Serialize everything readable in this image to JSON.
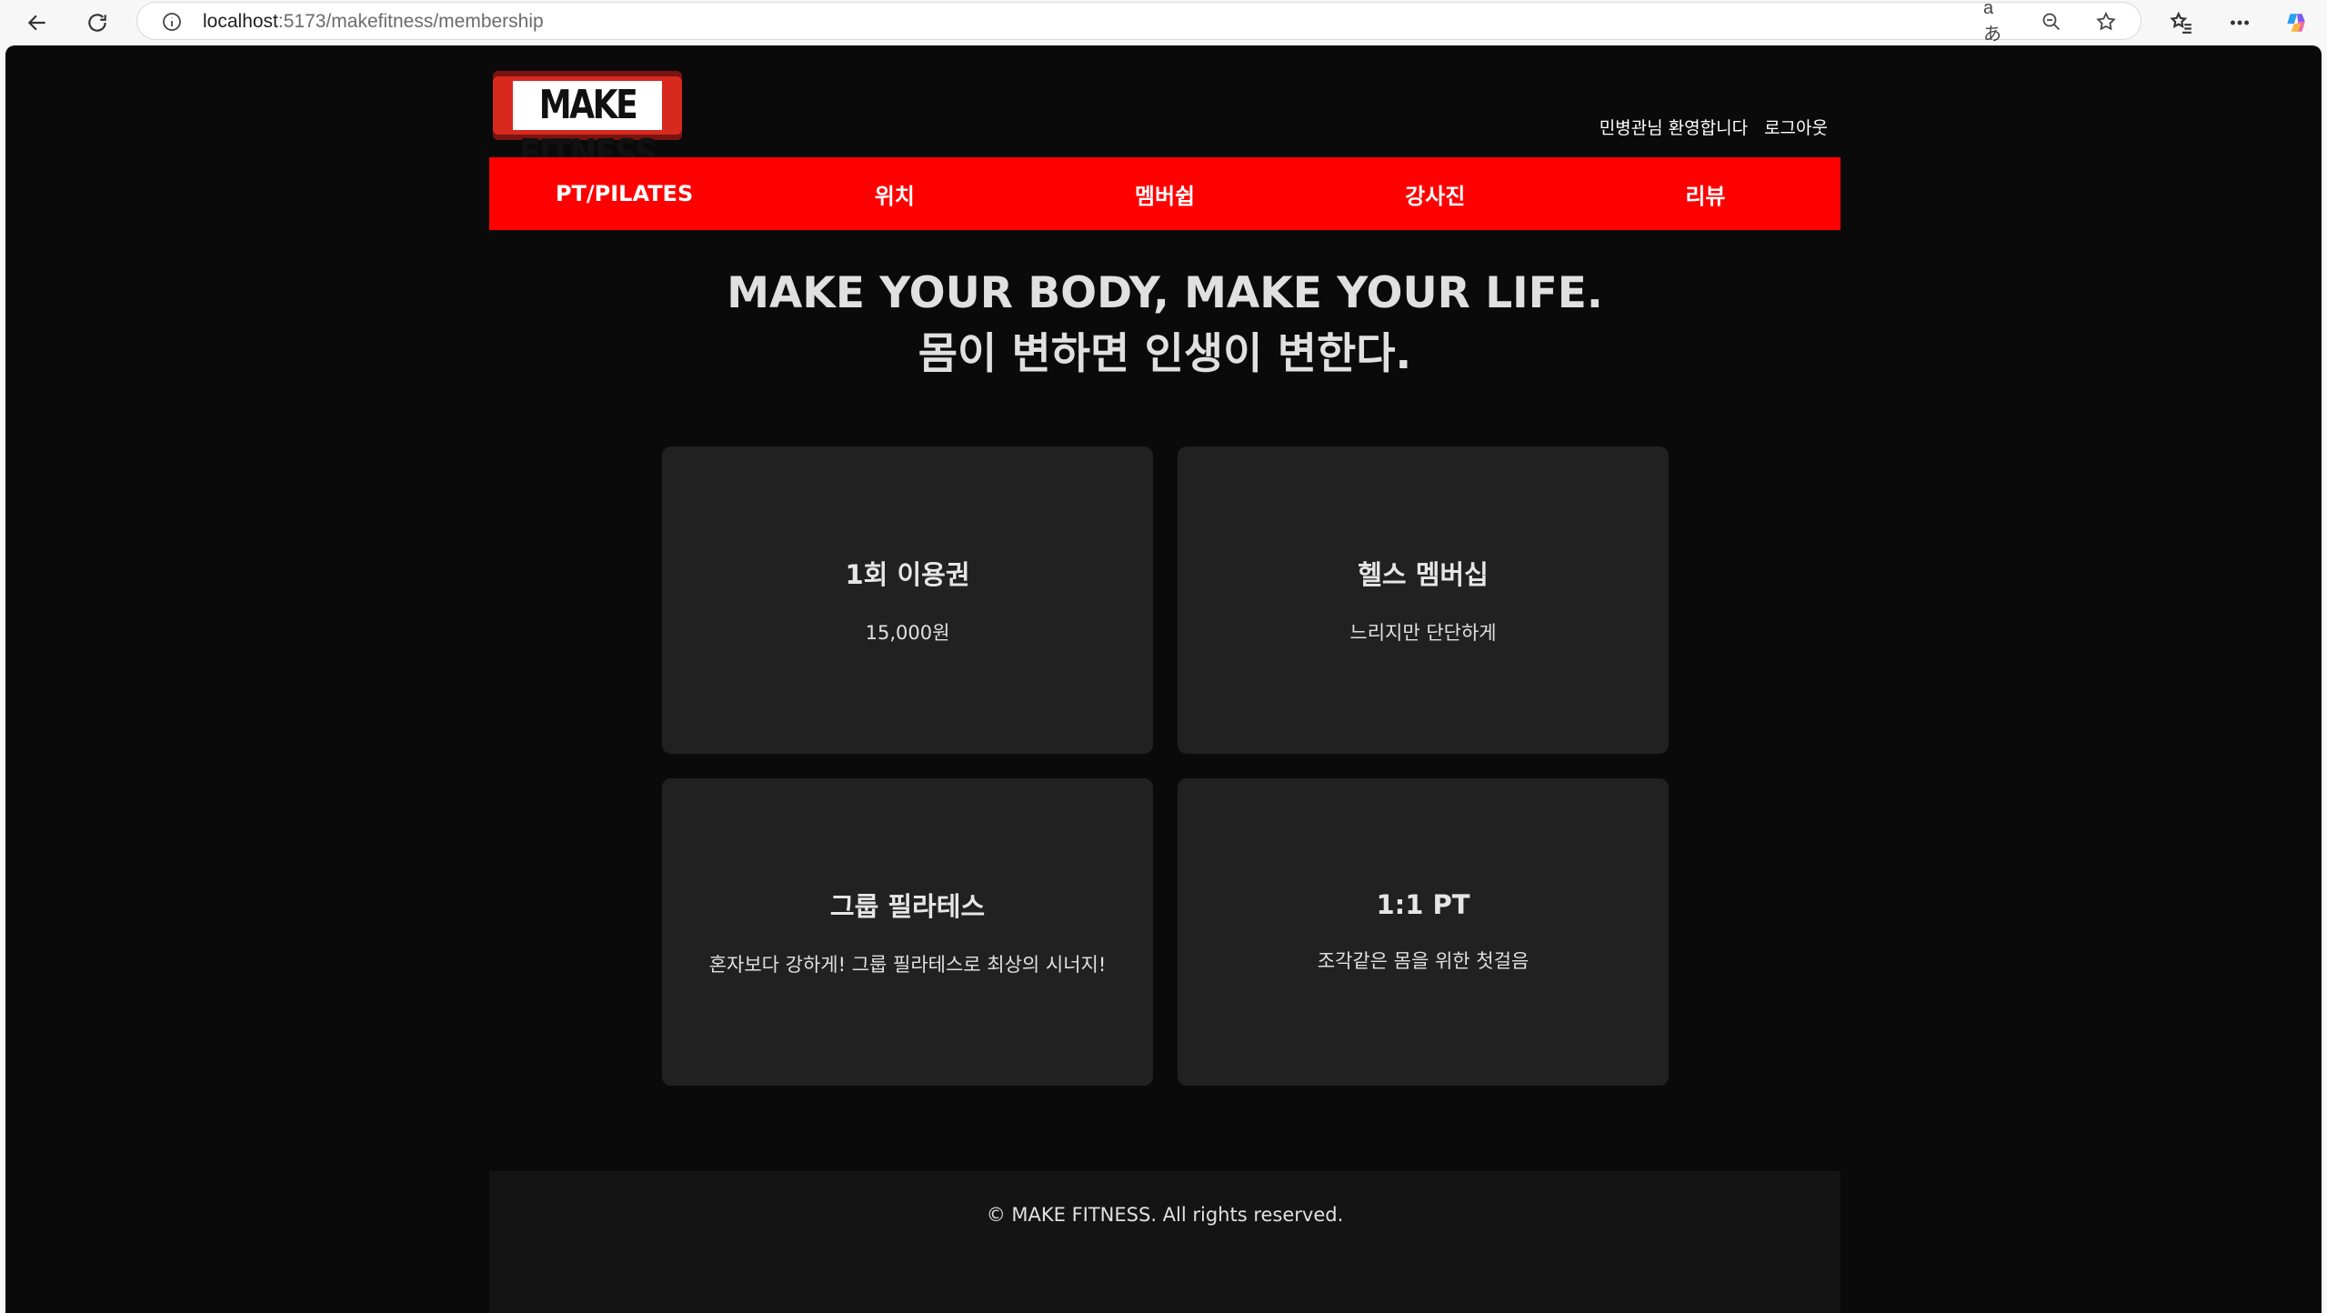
{
  "browser": {
    "url_host": "localhost",
    "url_rest": ":5173/makefitness/membership",
    "read_aloud_label": "aあ"
  },
  "site": {
    "logo_text": "MAKE FITNESS",
    "user_greeting": "민병관님 환영합니다",
    "logout_label": "로그아웃",
    "nav": [
      "PT/PILATES",
      "위치",
      "멤버쉽",
      "강사진",
      "리뷰"
    ],
    "hero_line1": "MAKE YOUR BODY, MAKE YOUR LIFE.",
    "hero_line2": "몸이 변하면 인생이 변한다.",
    "cards": [
      {
        "title": "1회 이용권",
        "desc": "15,000원"
      },
      {
        "title": "헬스 멤버십",
        "desc": "느리지만 단단하게"
      },
      {
        "title": "그룹 필라테스",
        "desc": "혼자보다 강하게! 그룹 필라테스로 최상의 시너지!"
      },
      {
        "title": "1:1 PT",
        "desc": "조각같은 몸을 위한 첫걸음"
      }
    ],
    "footer": "© MAKE FITNESS. All rights reserved."
  },
  "colors": {
    "nav_bg": "#ff0000",
    "page_bg": "#0a0a0a",
    "card_bg": "#212121"
  }
}
